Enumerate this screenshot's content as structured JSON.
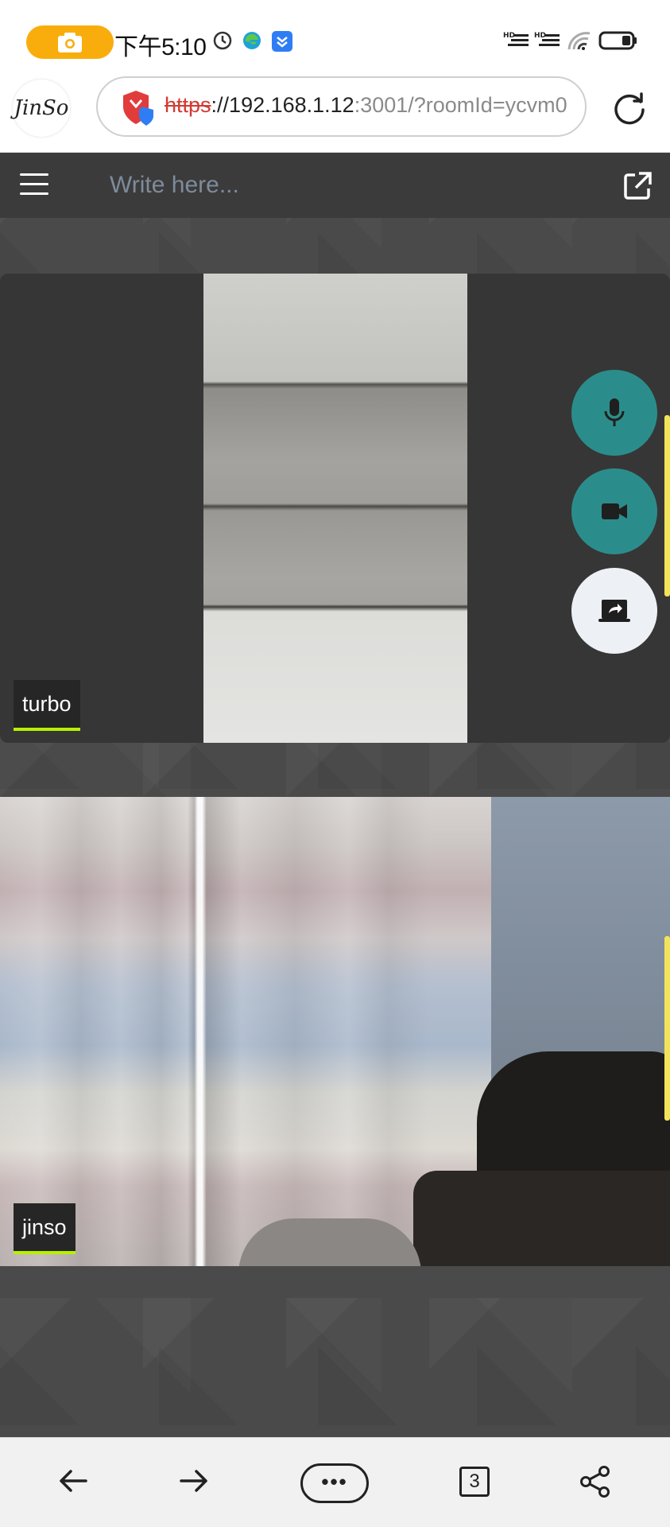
{
  "status_bar": {
    "time": "下午5:10",
    "icons": [
      "camera-recording-icon",
      "alarm-icon",
      "edge-browser-icon",
      "shield-app-icon",
      "hd-signal-icon",
      "hd-signal-icon",
      "wifi-icon",
      "battery-icon"
    ]
  },
  "address_bar": {
    "logo_text": "JinSo",
    "url_scheme": "https",
    "url_host": "://192.168.1.12",
    "url_rest": ":3001/?roomId=ycvm0",
    "icons": [
      "security-warning-icon",
      "reload-icon"
    ]
  },
  "topbar": {
    "message_placeholder": "Write here...",
    "icons": [
      "hamburger-menu-icon",
      "popout-icon"
    ]
  },
  "participants": [
    {
      "name": "turbo"
    },
    {
      "name": "jinso"
    }
  ],
  "controls": {
    "icons": [
      "microphone-icon",
      "video-camera-icon",
      "screen-share-icon"
    ],
    "colors": {
      "active": "#2b8d8b",
      "inactive": "#edf1f6",
      "name_underline": "#b7f000"
    }
  },
  "bottom_nav": {
    "more_label": "•••",
    "tab_count": "3",
    "icons": [
      "back-arrow-icon",
      "forward-arrow-icon",
      "more-icon",
      "tabs-icon",
      "share-icon"
    ]
  }
}
